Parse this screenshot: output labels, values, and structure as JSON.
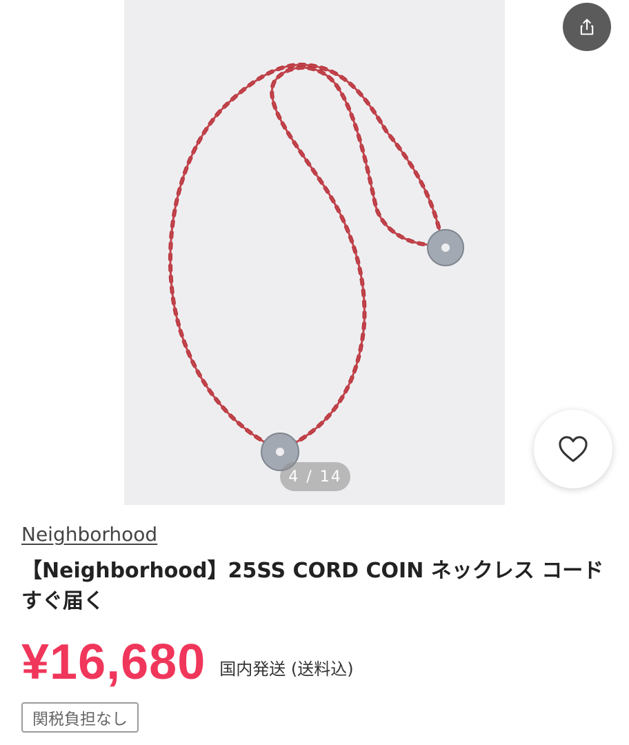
{
  "gallery": {
    "counter_current": "4",
    "counter_separator": "/",
    "counter_total": "14",
    "product_color": "#c2444c",
    "coin_color": "#9ea4ad"
  },
  "actions": {
    "share_icon": "share-icon",
    "favorite_icon": "heart-icon"
  },
  "product": {
    "brand": "Neighborhood",
    "title": "【Neighborhood】25SS CORD COIN ネックレス コード すぐ届く",
    "price": "¥16,680",
    "shipping": "国内発送 (送料込)",
    "tag": "関税負担なし"
  },
  "colors": {
    "price": "#f0365b",
    "share_button_bg": "#5b5b5b"
  }
}
